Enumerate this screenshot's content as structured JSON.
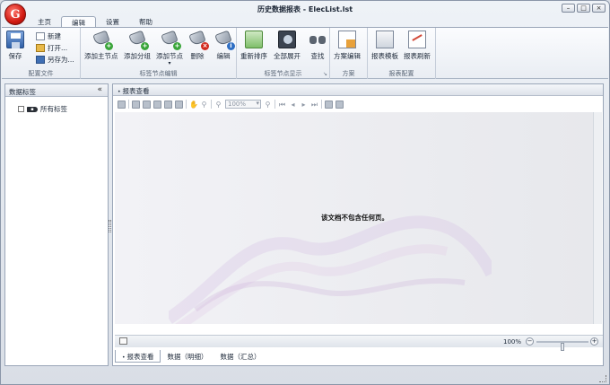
{
  "window": {
    "title": "历史数据报表 - ElecList.lst",
    "minimize": "–",
    "maximize": "□",
    "close": "×"
  },
  "tabs": [
    {
      "label": "主页"
    },
    {
      "label": "编辑",
      "active": true
    },
    {
      "label": "设置"
    },
    {
      "label": "帮助"
    }
  ],
  "ribbon": {
    "config_file": {
      "label": "配置文件",
      "save": "保存",
      "new": "新建",
      "open": "打开...",
      "save_as": "另存为..."
    },
    "tag_node_edit": {
      "label": "标签节点编辑",
      "add_main": "添加主节点",
      "add_group": "添加分组",
      "add_node": "添加节点",
      "delete": "删除",
      "edit": "编辑"
    },
    "tag_node_display": {
      "label": "标签节点显示",
      "reorder": "重新排序",
      "expand_all": "全部展开",
      "find": "查找"
    },
    "scheme": {
      "label": "方案",
      "scheme_edit": "方案编辑"
    },
    "report_config": {
      "label": "报表配置",
      "template": "报表模板",
      "refresh": "报表刷新"
    }
  },
  "left_panel": {
    "title": "数据标签",
    "collapse": "«",
    "tree": [
      {
        "label": "所有标签"
      }
    ]
  },
  "right_panel": {
    "title": "报表查看",
    "zoom_combo": "100%",
    "empty_message": "该文档不包含任何页。",
    "zoom_level": "100%",
    "zoom_slider_fraction": 0.5,
    "bottom_tabs": [
      {
        "label": "报表查看",
        "active": true
      },
      {
        "label": "数据（明细）"
      },
      {
        "label": "数据（汇总）"
      }
    ]
  },
  "colors": {
    "accent_green": "#3aa53a",
    "accent_red": "#d22a1e",
    "accent_blue": "#2f6fc4"
  }
}
